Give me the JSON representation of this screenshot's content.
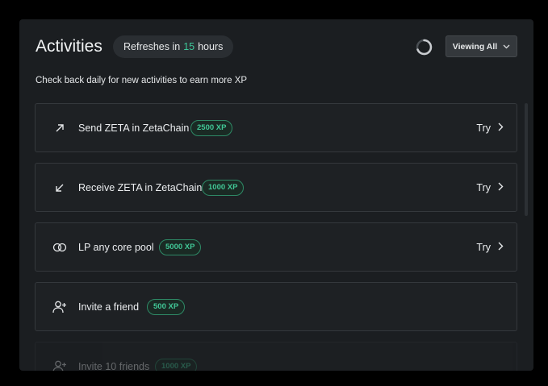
{
  "header": {
    "title": "Activities",
    "refresh_prefix": "Refreshes in",
    "refresh_value": "15",
    "refresh_unit": "hours",
    "loading_icon": "spinner-icon",
    "filter_label": "Viewing All",
    "filter_icon": "chevron-down-icon"
  },
  "subtitle": "Check back daily for new activities to earn more XP",
  "activities": [
    {
      "label": "Send ZETA in ZetaChain",
      "xp": "2500 XP",
      "icon": "arrow-up-right-icon",
      "action": "Try"
    },
    {
      "label": "Receive ZETA in ZetaChain",
      "xp": "1000 XP",
      "icon": "arrow-down-left-icon",
      "action": "Try"
    },
    {
      "label": "LP any core pool",
      "xp": "5000 XP",
      "icon": "pool-icon",
      "action": "Try"
    },
    {
      "label": "Invite a friend",
      "xp": "500 XP",
      "icon": "user-plus-icon"
    },
    {
      "label": "Invite 10 friends",
      "xp": "1000 XP",
      "icon": "user-plus-icon"
    }
  ],
  "colors": {
    "accent": "#3ec99a",
    "panel": "#1b1e21",
    "card": "#1e2124"
  }
}
